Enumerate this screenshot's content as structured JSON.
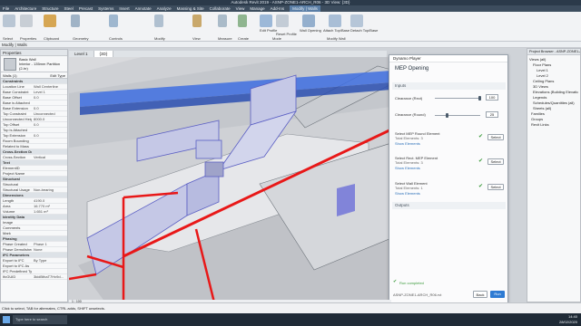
{
  "app": {
    "title": "Autodesk Revit 2019 - ASNP-ZONE1-ARCH_R06 - 3D View: {3D}"
  },
  "menu": [
    "File",
    "Architecture",
    "Structure",
    "Steel",
    "Precast",
    "Systems",
    "Insert",
    "Annotate",
    "Analyze",
    "Massing & Site",
    "Collaborate",
    "View",
    "Manage",
    "Add-Ins",
    "Modify | Walls"
  ],
  "menu_active": "Modify | Walls",
  "ribbon": {
    "groups": [
      "Select",
      "Properties",
      "Clipboard",
      "Geometry",
      "Controls",
      "Modify",
      "View",
      "Measure",
      "Create",
      "Mode",
      "Modify Wall"
    ],
    "tools": [
      "Edit Profile",
      "Reset Profile",
      "Wall Opening",
      "Attach Top/Base",
      "Detach Top/Base"
    ]
  },
  "context_bar": "Modify | Walls",
  "properties": {
    "header": "Properties",
    "type_family": "Basic Wall",
    "type_name": "Interior - 135mm Partition (2-hr)",
    "selector": "Walls (1)",
    "edit_type": "Edit Type",
    "rows": [
      {
        "k": "Constraints",
        "v": "",
        "sec": true
      },
      {
        "k": "Location Line",
        "v": "Wall Centerline"
      },
      {
        "k": "Base Constraint",
        "v": "Level 1"
      },
      {
        "k": "Base Offset",
        "v": "0.0"
      },
      {
        "k": "Base is Attached",
        "v": ""
      },
      {
        "k": "Base Extension",
        "v": "0.0"
      },
      {
        "k": "Top Constraint",
        "v": "Unconnected"
      },
      {
        "k": "Unconnected Height",
        "v": "8000.0"
      },
      {
        "k": "Top Offset",
        "v": "0.0"
      },
      {
        "k": "Top is Attached",
        "v": ""
      },
      {
        "k": "Top Extension",
        "v": "0.0"
      },
      {
        "k": "Room Bounding",
        "v": ""
      },
      {
        "k": "Related to Mass",
        "v": ""
      },
      {
        "k": "Cross-Section Definition",
        "v": "",
        "sec": true
      },
      {
        "k": "Cross-Section",
        "v": "Vertical"
      },
      {
        "k": "Text",
        "v": "",
        "sec": true
      },
      {
        "k": "ElementID",
        "v": ""
      },
      {
        "k": "Project Name",
        "v": ""
      },
      {
        "k": "Structural",
        "v": "",
        "sec": true
      },
      {
        "k": "Structural",
        "v": ""
      },
      {
        "k": "Structural Usage",
        "v": "Non-bearing"
      },
      {
        "k": "Dimensions",
        "v": "",
        "sec": true
      },
      {
        "k": "Length",
        "v": "4190.0"
      },
      {
        "k": "Area",
        "v": "16.770 m²"
      },
      {
        "k": "Volume",
        "v": "1.651 m³"
      },
      {
        "k": "Identity Data",
        "v": "",
        "sec": true
      },
      {
        "k": "Image",
        "v": ""
      },
      {
        "k": "Comments",
        "v": ""
      },
      {
        "k": "Mark",
        "v": ""
      },
      {
        "k": "Phasing",
        "v": "",
        "sec": true
      },
      {
        "k": "Phase Created",
        "v": "Phase 1"
      },
      {
        "k": "Phase Demolished",
        "v": "None"
      },
      {
        "k": "IFC Parameters",
        "v": "",
        "sec": true
      },
      {
        "k": "Export to IFC",
        "v": "By Type"
      },
      {
        "k": "Export to IFC As",
        "v": ""
      },
      {
        "k": "IFC Predefined Type",
        "v": ""
      },
      {
        "k": "IfcGUID",
        "v": "3kidBthaT7Hx9d..."
      }
    ],
    "help": "Properties help",
    "apply": "Apply"
  },
  "view_tabs": [
    "Level 1",
    "{3D}"
  ],
  "dynamo": {
    "window_title": "Dynamo Player",
    "title": "MEP Opening",
    "inputs_header": "Inputs",
    "clearance_rect_label": "Clearance (Rect)",
    "clearance_rect_value": "100",
    "clearance_round_label": "Clearance (Round)",
    "clearance_round_value": "25",
    "round_label": "Select MEP Round Element",
    "round_total": "Total Elements: 3",
    "round_show": "Show Elements",
    "rect_label": "Select Rect. MEP Element",
    "rect_total": "Total Elements: 3",
    "rect_show": "Show Elements",
    "wall_label": "Select Wall Element",
    "wall_total": "Total Elements: 1",
    "wall_show": "Show Elements",
    "select_btn": "Select",
    "outputs_header": "Outputs",
    "run_status": "Run completed",
    "file": "ASNP-ZONE1-ARCH_R06.rvt",
    "back": "Back",
    "run": "Run"
  },
  "browser": {
    "header": "Project Browser - ASNP-ZONE1-ARCH_R06",
    "items": [
      "Views (all)",
      "Floor Plans",
      "Level 1",
      "Level 2",
      "Ceiling Plans",
      "3D Views",
      "Elevations (Building Elevation)",
      "Legends",
      "Schedules/Quantities (all)",
      "Sheets (all)",
      "Families",
      "Groups",
      "Revit Links"
    ]
  },
  "view_scale": "1 : 100",
  "status": "Click to select, TAB for alternates, CTRL adds, SHIFT unselects.",
  "taskbar": {
    "search": "Type here to search",
    "time": "14:40",
    "date": "28/02/2020"
  },
  "colors": {
    "duct_blue": "#3f6fe0",
    "pipe_red": "#e81818",
    "accent": "#5a7ea6"
  }
}
